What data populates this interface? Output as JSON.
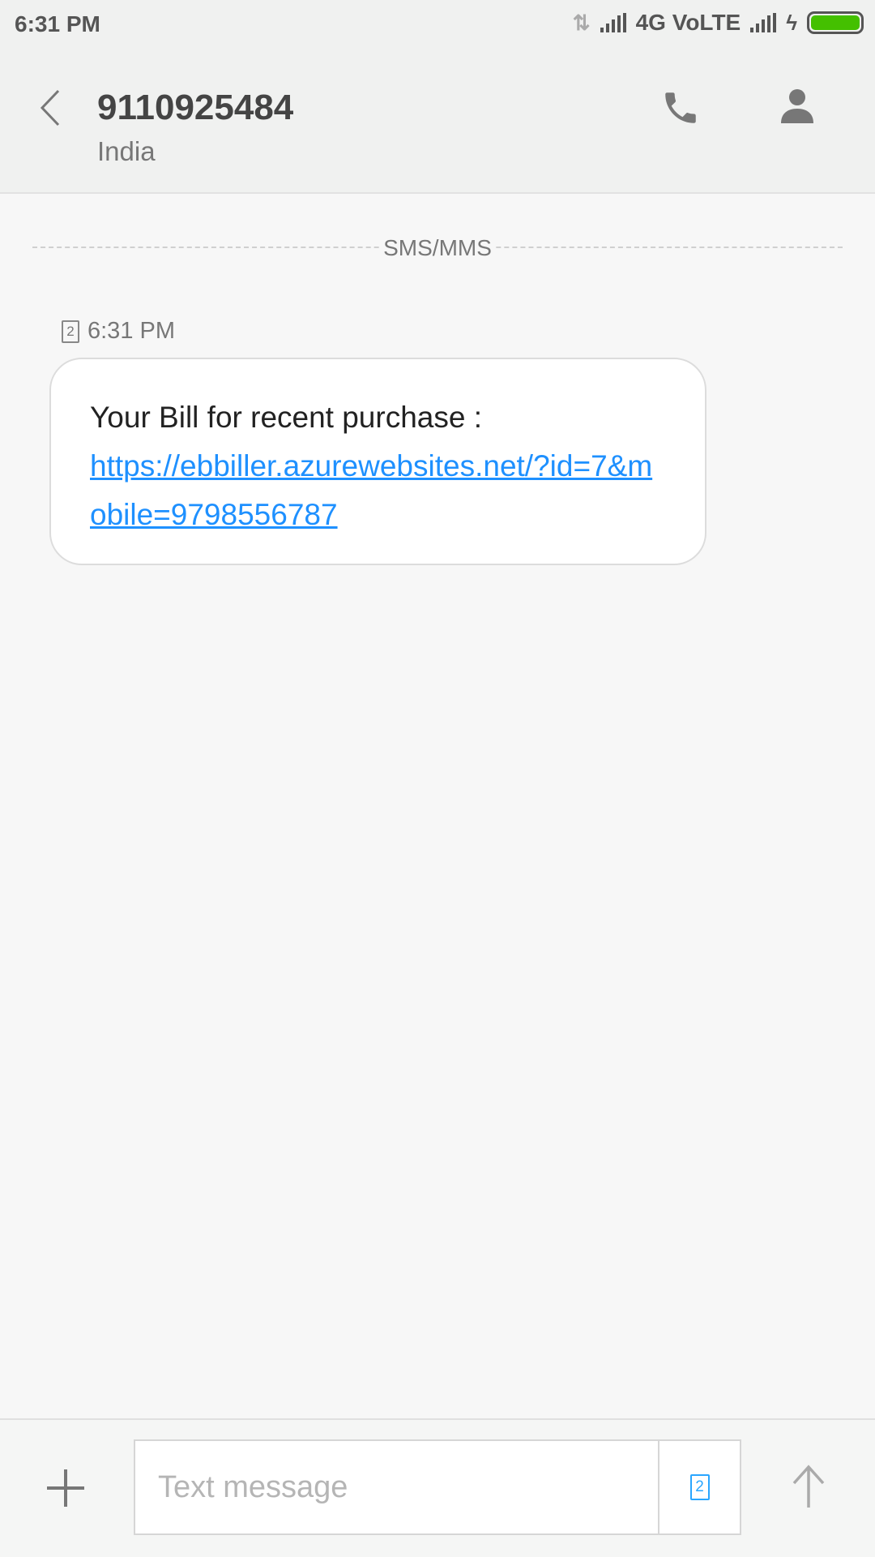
{
  "status_bar": {
    "time": "6:31 PM",
    "network": "4G VoLTE",
    "battery_level": 1.0,
    "battery_color": "#44c000"
  },
  "header": {
    "title": "9110925484",
    "subtitle": "India"
  },
  "thread": {
    "divider_label": "SMS/MMS",
    "messages": [
      {
        "sim": "2",
        "time": "6:31 PM",
        "text": "Your Bill for recent purchase :",
        "link": "https://ebbiller.azurewebsites.net/?id=7&mobile=9798556787"
      }
    ]
  },
  "composer": {
    "placeholder": "Text message",
    "sim": "2"
  },
  "colors": {
    "link": "#1e90ff",
    "accent": "#2aa6ff"
  }
}
